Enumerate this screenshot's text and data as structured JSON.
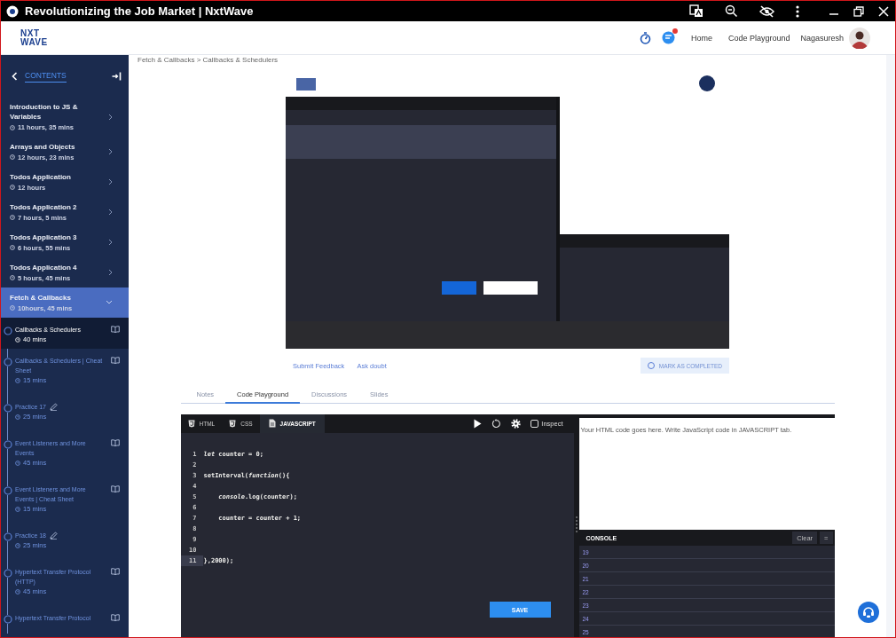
{
  "window": {
    "title": "Revolutionizing the Job Market | NxtWave"
  },
  "header": {
    "logo": [
      "NXT",
      "WAVE"
    ],
    "chat_unread": true,
    "nav": [
      {
        "label": "Home"
      },
      {
        "label": "Code Playground"
      }
    ],
    "user": {
      "name": "Nagasuresh"
    }
  },
  "sidebar": {
    "heading": "CONTENTS",
    "modules": [
      {
        "title": "Introduction to JS & Variables",
        "duration": "11 hours, 35 mins",
        "selected": false,
        "expanded": false
      },
      {
        "title": "Arrays and Objects",
        "duration": "12 hours, 23 mins",
        "selected": false,
        "expanded": false
      },
      {
        "title": "Todos Application",
        "duration": "12 hours",
        "selected": false,
        "expanded": false
      },
      {
        "title": "Todos Application 2",
        "duration": "7 hours, 5 mins",
        "selected": false,
        "expanded": false
      },
      {
        "title": "Todos Application 3",
        "duration": "6 hours, 55 mins",
        "selected": false,
        "expanded": false
      },
      {
        "title": "Todos Application 4",
        "duration": "5 hours, 45 mins",
        "selected": false,
        "expanded": false
      },
      {
        "title": "Fetch & Callbacks",
        "duration": "10hours, 45 mins",
        "selected": true,
        "expanded": true,
        "children": [
          {
            "title": "Callbacks & Schedulers",
            "duration": "40 mins",
            "kind": "reading",
            "selected": true
          },
          {
            "title": "Callbacks & Schedulers | Cheat Sheet",
            "duration": "15 mins",
            "kind": "reading",
            "selected": false
          },
          {
            "title": "Practice 17",
            "duration": "25 mins",
            "kind": "practice",
            "selected": false
          },
          {
            "title": "Event Listeners and More Events",
            "duration": "45 mins",
            "kind": "reading",
            "selected": false
          },
          {
            "title": "Event Listeners and More Events | Cheat Sheet",
            "duration": "15 mins",
            "kind": "reading",
            "selected": false
          },
          {
            "title": "Practice 18",
            "duration": "25 mins",
            "kind": "practice",
            "selected": false
          },
          {
            "title": "Hypertext Transfer Protocol (HTTP)",
            "duration": "45 mins",
            "kind": "reading",
            "selected": false
          },
          {
            "title": "Hypertext Transfer Protocol",
            "kind": "reading",
            "selected": false
          }
        ]
      }
    ]
  },
  "breadcrumb": "Fetch & Callbacks > Callbacks & Schedulers",
  "actions": {
    "links": [
      "Submit Feedback",
      "Ask doubt"
    ],
    "mark_complete": {
      "label": "MARK AS COMPLETED",
      "checked": false
    }
  },
  "tabs": [
    {
      "label": "Notes",
      "selected": false
    },
    {
      "label": "Code Playground",
      "selected": true
    },
    {
      "label": "Discussions",
      "selected": false
    },
    {
      "label": "Slides",
      "selected": false
    }
  ],
  "playground": {
    "editor_tabs": [
      {
        "label": "HTML",
        "kind": "html",
        "selected": false
      },
      {
        "label": "CSS",
        "kind": "css",
        "selected": false
      },
      {
        "label": "JAVASCRIPT",
        "kind": "js",
        "selected": true
      }
    ],
    "inspect": {
      "label": "Inspect",
      "checked": false
    },
    "lines": [
      {
        "number": "1",
        "active": false,
        "text": "*let* counter = 0;"
      },
      {
        "number": "2",
        "active": false
      },
      {
        "number": "3",
        "active": false,
        "text": "setInterval(*function*(){"
      },
      {
        "number": "4",
        "active": false
      },
      {
        "number": "5",
        "active": false,
        "text": "    *console*.log(counter);"
      },
      {
        "number": "6",
        "active": false
      },
      {
        "number": "7",
        "active": false,
        "text": "    counter = counter + 1;"
      },
      {
        "number": "8",
        "active": false
      },
      {
        "number": "9",
        "active": false
      },
      {
        "number": "10",
        "active": false
      },
      {
        "number": "11",
        "active": true,
        "text": "},2000);"
      }
    ],
    "save": "SAVE",
    "preview_text": "Your HTML code goes here. Write JavaScript code in JAVASCRIPT tab.",
    "console": {
      "title": "CONSOLE",
      "clear": "Clear",
      "menu": "=",
      "rows": [
        "19",
        "20",
        "21",
        "22",
        "23",
        "24",
        "25"
      ]
    }
  }
}
